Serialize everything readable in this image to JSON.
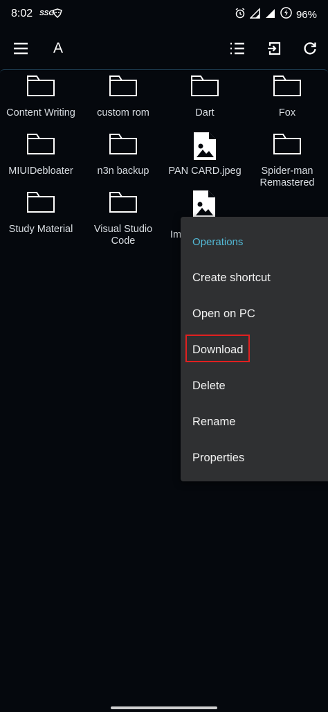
{
  "status_bar": {
    "time": "8:02",
    "carrier_badge": "SSG",
    "battery_percent": "96%"
  },
  "toolbar": {
    "title": "A",
    "icons": [
      "menu-icon",
      "list-view-icon",
      "exit-icon",
      "refresh-icon"
    ]
  },
  "files": [
    {
      "name": "Content Writing",
      "type": "folder"
    },
    {
      "name": "custom rom",
      "type": "folder"
    },
    {
      "name": "Dart",
      "type": "folder"
    },
    {
      "name": "Fox",
      "type": "folder"
    },
    {
      "name": "MIUIDebloater",
      "type": "folder"
    },
    {
      "name": "n3n backup",
      "type": "folder"
    },
    {
      "name": "PAN CARD.jpeg",
      "type": "image"
    },
    {
      "name": "Spider-man\nRemastered",
      "type": "folder"
    },
    {
      "name": "Study Material",
      "type": "folder"
    },
    {
      "name": "Visual Studio\nCode",
      "type": "folder"
    },
    {
      "name": "Im",
      "type": "image"
    }
  ],
  "context_menu": {
    "header": "Operations",
    "items": [
      "Create shortcut",
      "Open on PC",
      "Download",
      "Delete",
      "Rename",
      "Properties"
    ],
    "highlighted": "Download"
  },
  "colors": {
    "background": "#05080d",
    "menu_bg": "#2f3032",
    "accent": "#53b9d6",
    "highlight": "#e02020"
  }
}
